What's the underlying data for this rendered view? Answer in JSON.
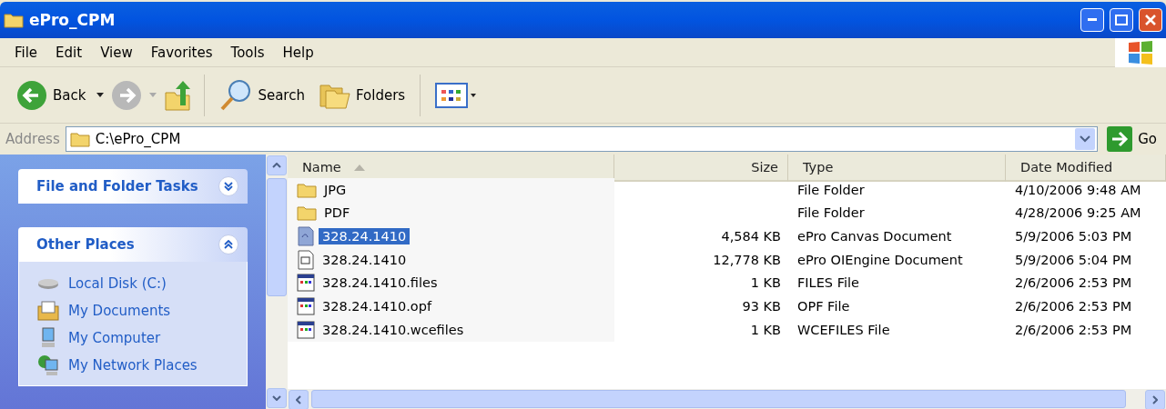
{
  "window": {
    "title": "ePro_CPM"
  },
  "menu": [
    "File",
    "Edit",
    "View",
    "Favorites",
    "Tools",
    "Help"
  ],
  "toolbar": {
    "back": "Back",
    "search": "Search",
    "folders": "Folders"
  },
  "address": {
    "label": "Address",
    "value": "C:\\ePro_CPM",
    "go": "Go"
  },
  "sidebar": {
    "panels": [
      {
        "title": "File and Folder Tasks",
        "expanded": false
      },
      {
        "title": "Other Places",
        "expanded": true,
        "items": [
          {
            "label": "Local Disk (C:)",
            "kind": "disk"
          },
          {
            "label": "My Documents",
            "kind": "documents"
          },
          {
            "label": "My Computer",
            "kind": "computer"
          },
          {
            "label": "My Network Places",
            "kind": "network"
          }
        ]
      }
    ]
  },
  "table": {
    "columns": [
      {
        "label": "Name",
        "sorted": true
      },
      {
        "label": "Size",
        "sorted": false
      },
      {
        "label": "Type",
        "sorted": false
      },
      {
        "label": "Date Modified",
        "sorted": false
      }
    ],
    "rows": [
      {
        "kind": "folder",
        "name": "JPG",
        "size": "",
        "type": "File Folder",
        "date": "4/10/2006 9:48 AM",
        "selected": false
      },
      {
        "kind": "folder",
        "name": "PDF",
        "size": "",
        "type": "File Folder",
        "date": "4/28/2006 9:25 AM",
        "selected": false
      },
      {
        "kind": "canvas",
        "name": "328.24.1410",
        "size": "4,584 KB",
        "type": "ePro Canvas Document",
        "date": "5/9/2006 5:03 PM",
        "selected": true
      },
      {
        "kind": "engine",
        "name": "328.24.1410",
        "size": "12,778 KB",
        "type": "ePro OIEngine Document",
        "date": "5/9/2006 5:04 PM",
        "selected": false
      },
      {
        "kind": "generic",
        "name": "328.24.1410.files",
        "size": "1 KB",
        "type": "FILES File",
        "date": "2/6/2006 2:53 PM",
        "selected": false
      },
      {
        "kind": "generic",
        "name": "328.24.1410.opf",
        "size": "93 KB",
        "type": "OPF File",
        "date": "2/6/2006 2:53 PM",
        "selected": false
      },
      {
        "kind": "generic",
        "name": "328.24.1410.wcefiles",
        "size": "1 KB",
        "type": "WCEFILES File",
        "date": "2/6/2006 2:53 PM",
        "selected": false
      }
    ]
  }
}
